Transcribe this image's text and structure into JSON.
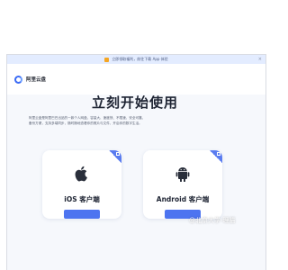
{
  "banner": {
    "text": "立即领取福利，前往下载 App 体验",
    "dismiss_label": "×"
  },
  "header": {
    "brand": "阿里云盘"
  },
  "hero": {
    "title": "立刻开始使用",
    "description": "阿里云盘是阿里巴巴出品的一款个人网盘，容量大、速度快、不限速、安全可靠、备份方便，支持多端同步，随时随地查看你的照片与文件，开启你的数字生活。"
  },
  "cards": {
    "ios": {
      "label": "iOS 客户端",
      "icon": "apple-icon"
    },
    "android": {
      "label": "Android 客户端",
      "icon": "android-icon"
    }
  },
  "watermark": "@北京大学-理猫",
  "colors": {
    "accent": "#4d74f0",
    "banner_bg": "#e3ecff",
    "hero_bg": "#f6f8fc"
  }
}
